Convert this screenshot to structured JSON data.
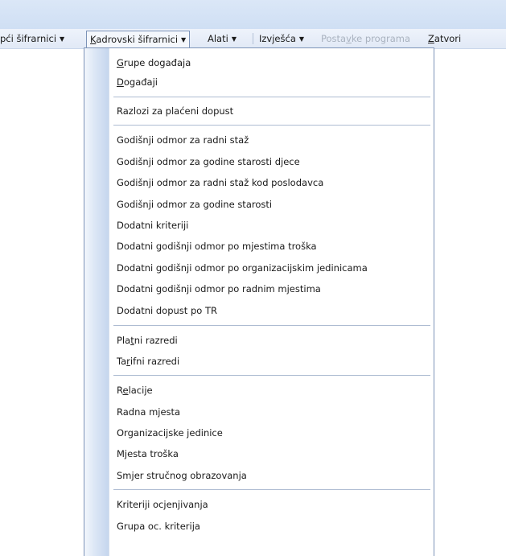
{
  "menubar": {
    "items": [
      {
        "before": "",
        "mnemonic": "",
        "after": "pći šifrarnici",
        "arrow": "▼"
      },
      {
        "before": "",
        "mnemonic": "K",
        "after": "adrovski šifrarnici",
        "arrow": "▼"
      },
      {
        "before": "",
        "mnemonic": "",
        "after": "Alati",
        "arrow": "▼"
      },
      {
        "before": "",
        "mnemonic": "",
        "after": "Izvješća",
        "arrow": "▼"
      },
      {
        "before": "Posta",
        "mnemonic": "v",
        "after": "ke programa",
        "arrow": ""
      },
      {
        "before": "",
        "mnemonic": "Z",
        "after": "atvori",
        "arrow": ""
      }
    ]
  },
  "dropdown": {
    "items": [
      {
        "before": "",
        "mnemonic": "G",
        "after": "rupe događaja"
      },
      {
        "before": "",
        "mnemonic": "D",
        "after": "ogađaji"
      },
      {
        "before": "",
        "mnemonic": "",
        "after": "Razlozi za plaćeni dopust"
      },
      {
        "before": "",
        "mnemonic": "",
        "after": "Godišnji odmor za radni staž"
      },
      {
        "before": "",
        "mnemonic": "",
        "after": "Godišnji odmor za godine starosti djece"
      },
      {
        "before": "",
        "mnemonic": "",
        "after": "Godišnji odmor za radni staž kod poslodavca"
      },
      {
        "before": "",
        "mnemonic": "",
        "after": "Godišnji odmor za godine starosti"
      },
      {
        "before": "",
        "mnemonic": "",
        "after": "Dodatni kriteriji"
      },
      {
        "before": "",
        "mnemonic": "",
        "after": "Dodatni godišnji odmor po mjestima troška"
      },
      {
        "before": "",
        "mnemonic": "",
        "after": "Dodatni godišnji odmor po organizacijskim jedinicama"
      },
      {
        "before": "",
        "mnemonic": "",
        "after": "Dodatni godišnji odmor po radnim mjestima"
      },
      {
        "before": "",
        "mnemonic": "",
        "after": "Dodatni dopust po TR"
      },
      {
        "before": "Pla",
        "mnemonic": "t",
        "after": "ni razredi"
      },
      {
        "before": "Ta",
        "mnemonic": "r",
        "after": "ifni razredi"
      },
      {
        "before": "R",
        "mnemonic": "e",
        "after": "lacije"
      },
      {
        "before": "",
        "mnemonic": "",
        "after": "Radna mjesta"
      },
      {
        "before": "",
        "mnemonic": "",
        "after": "Organizacijske jedinice"
      },
      {
        "before": "",
        "mnemonic": "",
        "after": "Mjesta troška"
      },
      {
        "before": "",
        "mnemonic": "",
        "after": "Smjer stručnog obrazovanja"
      },
      {
        "before": "",
        "mnemonic": "",
        "after": "Kriteriji  ocjenjivanja"
      },
      {
        "before": "",
        "mnemonic": "",
        "after": "Grupa oc. kriterija"
      }
    ]
  }
}
